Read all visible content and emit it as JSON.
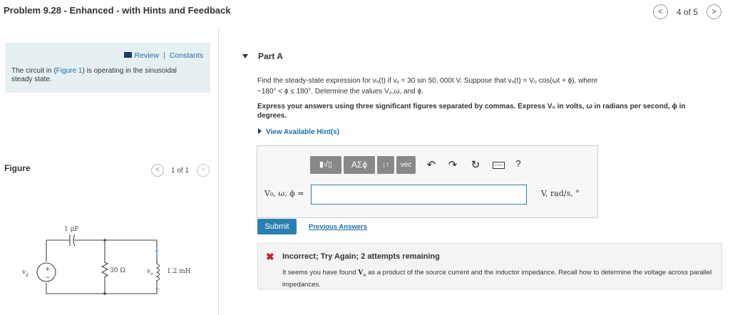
{
  "header": {
    "title": "Problem 9.28 - Enhanced - with Hints and Feedback",
    "prev_glyph": "<",
    "next_glyph": ">",
    "pager": "4 of 5"
  },
  "left": {
    "review_label": "Review",
    "separator": "|",
    "constants_label": "Constants",
    "intro_before": "The circuit in (",
    "intro_link": "Figure 1",
    "intro_after": ") is operating in the sinusoidal steady state.",
    "figure_label": "Figure",
    "figure_pager": "1 of 1",
    "figure_prev_glyph": "<",
    "figure_next_glyph": ">"
  },
  "circuit": {
    "source_label": "v",
    "source_sub": "g",
    "capacitor_label": "1 μF",
    "resistor_label": "30 Ω",
    "voltage_label": "v",
    "voltage_sub": "o",
    "inductor_label": "1.2 mH",
    "plus": "+",
    "minus": "−",
    "src_plus": "+",
    "src_minus": "−"
  },
  "part": {
    "label": "Part A",
    "question_line1": "Find the steady-state expression for vₒ(t) if vᵧ = 30 sin 50, 000t V. Suppose that vₒ(t) = V₀ cos(ωt + ϕ), where",
    "question_line2": "−180° < ϕ ≤ 180°. Determine the values V₀,ω, and ϕ.",
    "instructions": "Express your answers using three significant figures separated by commas. Express V₀ in volts, ω in radians per second, ϕ in degrees.",
    "hints_label": "View Available Hint(s)"
  },
  "toolbar": {
    "template_glyph": "▮√▯",
    "greek_glyph": "ΑΣϕ",
    "sort_glyph": "↓↑",
    "vec_label": "vec",
    "undo_glyph": "↶",
    "redo_glyph": "↷",
    "reset_glyph": "↻",
    "help_glyph": "?"
  },
  "answer": {
    "label": "V₀, ω, ϕ =",
    "value": "",
    "units": "V, rad/s, °"
  },
  "actions": {
    "submit": "Submit",
    "previous_answers": "Previous Answers"
  },
  "feedback": {
    "icon": "✖",
    "title": "Incorrect; Try Again; 2 attempts remaining",
    "text_before": "It seems you have found ",
    "symbol": "V",
    "symbol_sub": "o",
    "text_after": " as a product of the source current and the inductor impedance. Recall how to determine the voltage across parallel impedances."
  },
  "colors": {
    "link": "#1a6fa8",
    "review_bg": "#e6f0f2",
    "submit_bg": "#2a7fb0",
    "error": "#c0211f",
    "toolbar_btn": "#888888"
  }
}
